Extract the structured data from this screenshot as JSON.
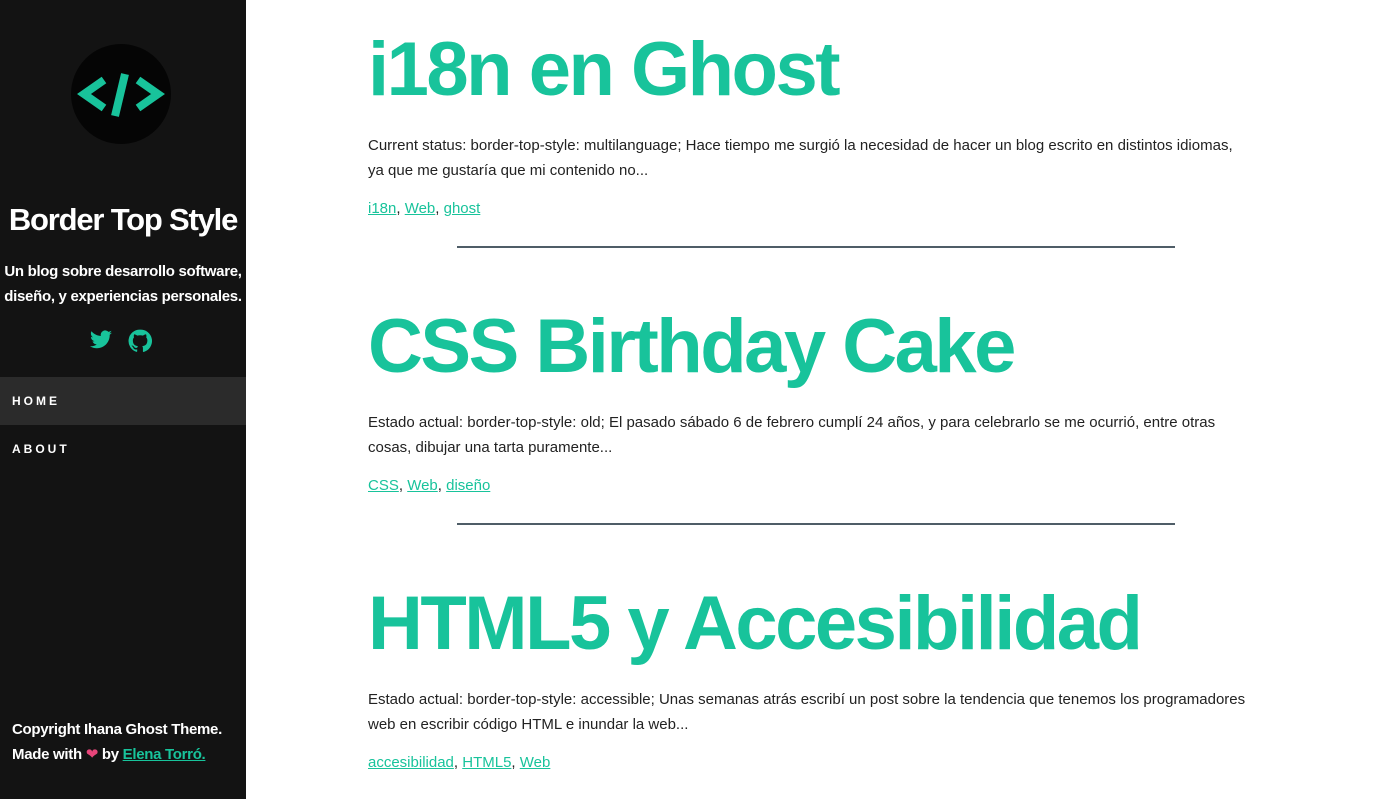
{
  "colors": {
    "accent": "#18c39b",
    "sidebar_bg": "#131313",
    "heart": "#e8457a",
    "divider": "#4f5d67"
  },
  "sidebar": {
    "logo_icon": "code-brackets-icon",
    "title": "Border Top Style",
    "description": "Un blog sobre desarrollo software, diseño, y experiencias personales.",
    "social": [
      {
        "icon": "twitter-icon"
      },
      {
        "icon": "github-icon"
      }
    ],
    "nav": [
      {
        "label": "HOME",
        "active": true
      },
      {
        "label": "ABOUT",
        "active": false
      }
    ],
    "footer": {
      "copyright": "Copyright Ihana Ghost Theme.",
      "made_with": "Made with",
      "heart": "❤",
      "by": "by",
      "author": "Elena Torró."
    }
  },
  "posts": [
    {
      "title": "i18n en Ghost",
      "excerpt": "Current status: border-top-style: multilanguage; Hace tiempo me surgió la necesidad de hacer un blog escrito en distintos idiomas, ya que me gustaría que mi contenido no...",
      "tags": [
        "i18n",
        "Web",
        "ghost"
      ]
    },
    {
      "title": "CSS Birthday Cake",
      "excerpt": "Estado actual: border-top-style: old; El pasado sábado 6 de febrero cumplí 24 años, y para celebrarlo se me ocurrió, entre otras cosas, dibujar una tarta puramente...",
      "tags": [
        "CSS",
        "Web",
        "diseño"
      ]
    },
    {
      "title": "HTML5 y Accesibilidad",
      "excerpt": "Estado actual: border-top-style: accessible; Unas semanas atrás escribí un post sobre la tendencia que tenemos los programadores web en escribir código HTML e inundar la web...",
      "tags": [
        "accesibilidad",
        "HTML5",
        "Web"
      ]
    }
  ]
}
